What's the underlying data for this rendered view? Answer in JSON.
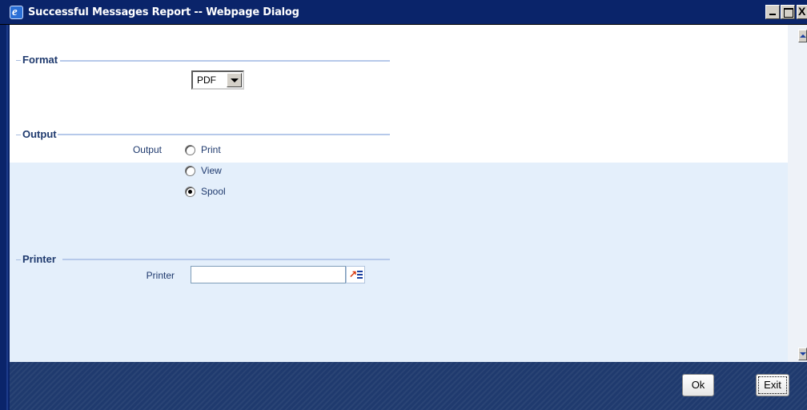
{
  "window": {
    "title": "Successful Messages Report -- Webpage Dialog",
    "close_glyph": "X"
  },
  "sections": {
    "format": {
      "title": "Format",
      "select_value": "PDF"
    },
    "output": {
      "title": "Output",
      "field_label": "Output",
      "options": [
        {
          "label": "Print",
          "checked": false
        },
        {
          "label": "View",
          "checked": false
        },
        {
          "label": "Spool",
          "checked": true
        }
      ]
    },
    "printer": {
      "title": "Printer",
      "field_label": "Printer",
      "value": ""
    }
  },
  "footer": {
    "ok_label": "Ok",
    "exit_label": "Exit"
  },
  "icons": {
    "title_icon": "ie-icon",
    "lov_icon": "list-of-values-icon"
  },
  "colors": {
    "titlebar": "#0a246a",
    "label_text": "#1f3a6e",
    "band": "#e4effb",
    "footer": "#1f3a6e"
  }
}
